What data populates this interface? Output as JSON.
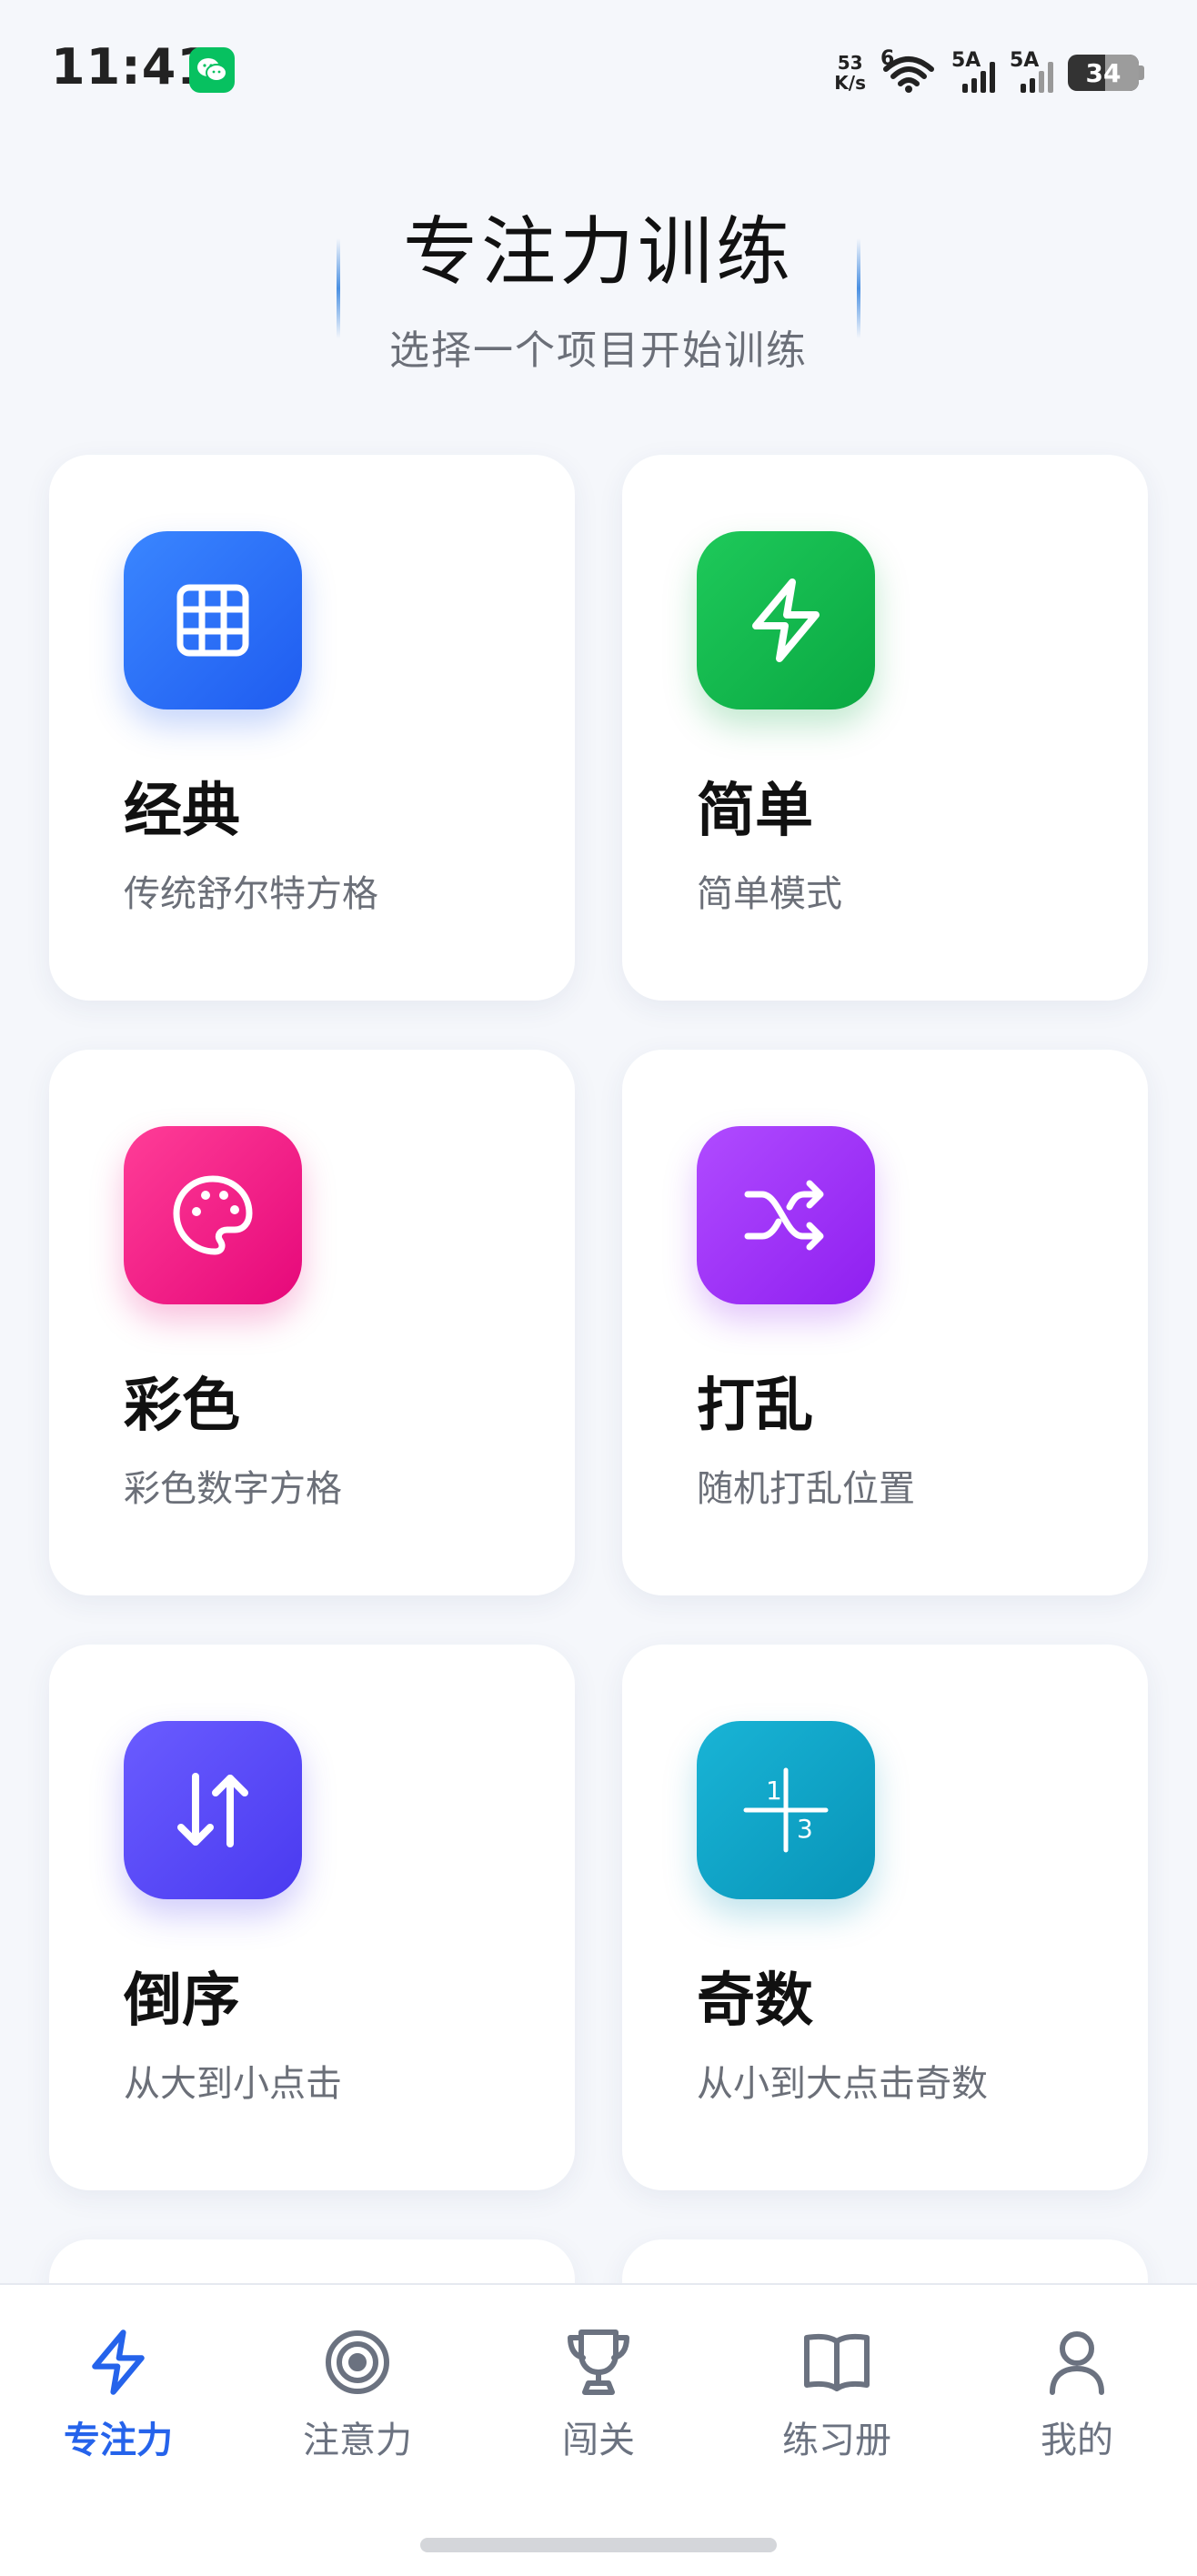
{
  "status_bar": {
    "time": "11:41",
    "net_speed_value": "53",
    "net_speed_unit": "K/s",
    "wifi_label": "6",
    "sim1_label": "5A",
    "sim2_label": "5A",
    "battery": "34"
  },
  "header": {
    "title": "专注力训练",
    "subtitle": "选择一个项目开始训练"
  },
  "cards": [
    {
      "title": "经典",
      "desc": "传统舒尔特方格",
      "icon": "grid-icon",
      "color_from": "#3a86ff",
      "color_to": "#1f5cf0"
    },
    {
      "title": "简单",
      "desc": "简单模式",
      "icon": "lightning-icon",
      "color_from": "#1ec95a",
      "color_to": "#0aa842"
    },
    {
      "title": "彩色",
      "desc": "彩色数字方格",
      "icon": "palette-icon",
      "color_from": "#ff3d97",
      "color_to": "#e6087a"
    },
    {
      "title": "打乱",
      "desc": "随机打乱位置",
      "icon": "shuffle-icon",
      "color_from": "#b04bff",
      "color_to": "#8f1ff0"
    },
    {
      "title": "倒序",
      "desc": "从大到小点击",
      "icon": "sort-arrows-icon",
      "color_from": "#6a5cff",
      "color_to": "#4a3af0"
    },
    {
      "title": "奇数",
      "desc": "从小到大点击奇数",
      "icon": "odd-numbers-icon",
      "color_from": "#19b4d6",
      "color_to": "#0894b8"
    }
  ],
  "odd_icon_digits": {
    "top": "1",
    "bottom": "3"
  },
  "bottom_nav": [
    {
      "label": "专注力",
      "icon": "lightning-icon",
      "active": true
    },
    {
      "label": "注意力",
      "icon": "target-icon",
      "active": false
    },
    {
      "label": "闯关",
      "icon": "trophy-icon",
      "active": false
    },
    {
      "label": "练习册",
      "icon": "book-icon",
      "active": false
    },
    {
      "label": "我的",
      "icon": "user-icon",
      "active": false
    }
  ],
  "colors": {
    "accent": "#2563eb",
    "background": "#f5f7fb",
    "inactive": "#6b7280"
  }
}
